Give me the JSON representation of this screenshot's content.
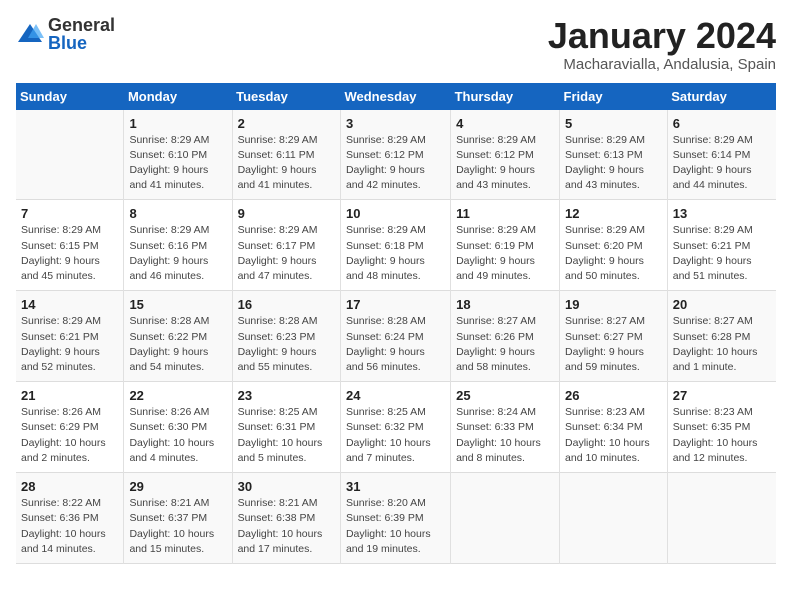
{
  "logo": {
    "general": "General",
    "blue": "Blue"
  },
  "title": "January 2024",
  "subtitle": "Macharavialla, Andalusia, Spain",
  "weekdays": [
    "Sunday",
    "Monday",
    "Tuesday",
    "Wednesday",
    "Thursday",
    "Friday",
    "Saturday"
  ],
  "weeks": [
    [
      {
        "day": "",
        "info": ""
      },
      {
        "day": "1",
        "info": "Sunrise: 8:29 AM\nSunset: 6:10 PM\nDaylight: 9 hours\nand 41 minutes."
      },
      {
        "day": "2",
        "info": "Sunrise: 8:29 AM\nSunset: 6:11 PM\nDaylight: 9 hours\nand 41 minutes."
      },
      {
        "day": "3",
        "info": "Sunrise: 8:29 AM\nSunset: 6:12 PM\nDaylight: 9 hours\nand 42 minutes."
      },
      {
        "day": "4",
        "info": "Sunrise: 8:29 AM\nSunset: 6:12 PM\nDaylight: 9 hours\nand 43 minutes."
      },
      {
        "day": "5",
        "info": "Sunrise: 8:29 AM\nSunset: 6:13 PM\nDaylight: 9 hours\nand 43 minutes."
      },
      {
        "day": "6",
        "info": "Sunrise: 8:29 AM\nSunset: 6:14 PM\nDaylight: 9 hours\nand 44 minutes."
      }
    ],
    [
      {
        "day": "7",
        "info": "Sunrise: 8:29 AM\nSunset: 6:15 PM\nDaylight: 9 hours\nand 45 minutes."
      },
      {
        "day": "8",
        "info": "Sunrise: 8:29 AM\nSunset: 6:16 PM\nDaylight: 9 hours\nand 46 minutes."
      },
      {
        "day": "9",
        "info": "Sunrise: 8:29 AM\nSunset: 6:17 PM\nDaylight: 9 hours\nand 47 minutes."
      },
      {
        "day": "10",
        "info": "Sunrise: 8:29 AM\nSunset: 6:18 PM\nDaylight: 9 hours\nand 48 minutes."
      },
      {
        "day": "11",
        "info": "Sunrise: 8:29 AM\nSunset: 6:19 PM\nDaylight: 9 hours\nand 49 minutes."
      },
      {
        "day": "12",
        "info": "Sunrise: 8:29 AM\nSunset: 6:20 PM\nDaylight: 9 hours\nand 50 minutes."
      },
      {
        "day": "13",
        "info": "Sunrise: 8:29 AM\nSunset: 6:21 PM\nDaylight: 9 hours\nand 51 minutes."
      }
    ],
    [
      {
        "day": "14",
        "info": "Sunrise: 8:29 AM\nSunset: 6:21 PM\nDaylight: 9 hours\nand 52 minutes."
      },
      {
        "day": "15",
        "info": "Sunrise: 8:28 AM\nSunset: 6:22 PM\nDaylight: 9 hours\nand 54 minutes."
      },
      {
        "day": "16",
        "info": "Sunrise: 8:28 AM\nSunset: 6:23 PM\nDaylight: 9 hours\nand 55 minutes."
      },
      {
        "day": "17",
        "info": "Sunrise: 8:28 AM\nSunset: 6:24 PM\nDaylight: 9 hours\nand 56 minutes."
      },
      {
        "day": "18",
        "info": "Sunrise: 8:27 AM\nSunset: 6:26 PM\nDaylight: 9 hours\nand 58 minutes."
      },
      {
        "day": "19",
        "info": "Sunrise: 8:27 AM\nSunset: 6:27 PM\nDaylight: 9 hours\nand 59 minutes."
      },
      {
        "day": "20",
        "info": "Sunrise: 8:27 AM\nSunset: 6:28 PM\nDaylight: 10 hours\nand 1 minute."
      }
    ],
    [
      {
        "day": "21",
        "info": "Sunrise: 8:26 AM\nSunset: 6:29 PM\nDaylight: 10 hours\nand 2 minutes."
      },
      {
        "day": "22",
        "info": "Sunrise: 8:26 AM\nSunset: 6:30 PM\nDaylight: 10 hours\nand 4 minutes."
      },
      {
        "day": "23",
        "info": "Sunrise: 8:25 AM\nSunset: 6:31 PM\nDaylight: 10 hours\nand 5 minutes."
      },
      {
        "day": "24",
        "info": "Sunrise: 8:25 AM\nSunset: 6:32 PM\nDaylight: 10 hours\nand 7 minutes."
      },
      {
        "day": "25",
        "info": "Sunrise: 8:24 AM\nSunset: 6:33 PM\nDaylight: 10 hours\nand 8 minutes."
      },
      {
        "day": "26",
        "info": "Sunrise: 8:23 AM\nSunset: 6:34 PM\nDaylight: 10 hours\nand 10 minutes."
      },
      {
        "day": "27",
        "info": "Sunrise: 8:23 AM\nSunset: 6:35 PM\nDaylight: 10 hours\nand 12 minutes."
      }
    ],
    [
      {
        "day": "28",
        "info": "Sunrise: 8:22 AM\nSunset: 6:36 PM\nDaylight: 10 hours\nand 14 minutes."
      },
      {
        "day": "29",
        "info": "Sunrise: 8:21 AM\nSunset: 6:37 PM\nDaylight: 10 hours\nand 15 minutes."
      },
      {
        "day": "30",
        "info": "Sunrise: 8:21 AM\nSunset: 6:38 PM\nDaylight: 10 hours\nand 17 minutes."
      },
      {
        "day": "31",
        "info": "Sunrise: 8:20 AM\nSunset: 6:39 PM\nDaylight: 10 hours\nand 19 minutes."
      },
      {
        "day": "",
        "info": ""
      },
      {
        "day": "",
        "info": ""
      },
      {
        "day": "",
        "info": ""
      }
    ]
  ]
}
